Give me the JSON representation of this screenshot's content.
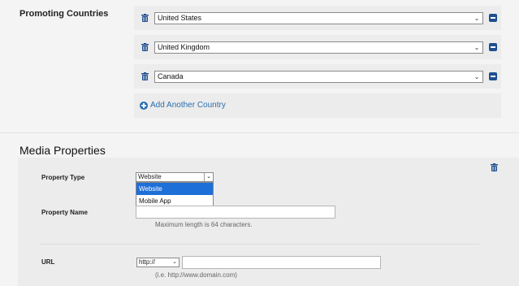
{
  "promoting": {
    "label": "Promoting Countries",
    "countries": [
      "United States",
      "United Kingdom",
      "Canada"
    ],
    "add_label": "Add Another Country"
  },
  "media": {
    "heading": "Media Properties",
    "property_type": {
      "label": "Property Type",
      "value": "Website",
      "options": [
        "Website",
        "Mobile App"
      ],
      "highlighted": "Website"
    },
    "property_name": {
      "label": "Property Name",
      "value": "",
      "hint": "Maximum length is 64 characters."
    },
    "url": {
      "label": "URL",
      "protocol": "http://",
      "value": "",
      "hint": "(i.e. http://www.domain.com)"
    }
  },
  "colors": {
    "accent": "#2a6fb0",
    "remove_button": "#1f4f8f",
    "dropdown_highlight": "#1e6fd8"
  }
}
